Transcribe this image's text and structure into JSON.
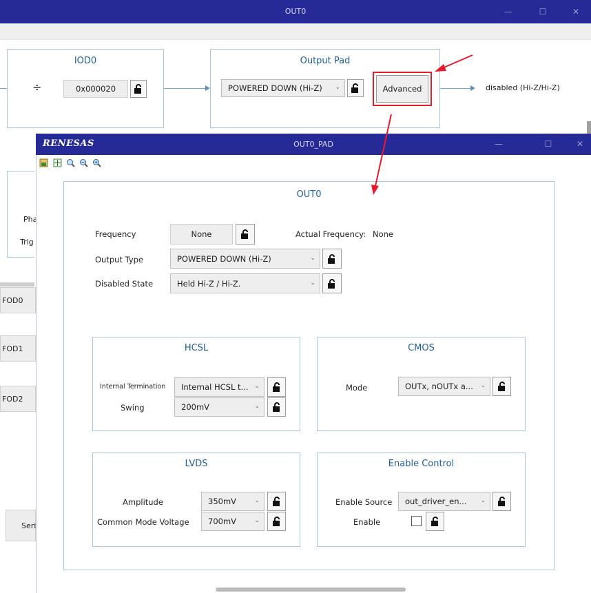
{
  "back_window": {
    "title": "OUT0",
    "iod": {
      "title": "IOD0",
      "divide_symbol": "÷",
      "value": "0x000020"
    },
    "output_pad": {
      "title": "Output Pad",
      "type_value": "POWERED DOWN (Hi-Z)",
      "advanced_label": "Advanced"
    },
    "output_status": "disabled (Hi-Z/Hi-Z)",
    "left_labels": [
      "Pha",
      "Trig"
    ],
    "side_buttons": [
      "FOD0",
      "FOD1",
      "FOD2",
      "Seri"
    ]
  },
  "front_window": {
    "logo": "RENESAS",
    "title": "OUT0_PAD",
    "toolbar": [
      "export-icon",
      "fit-icon",
      "zoom-reset-icon",
      "zoom-out-icon",
      "zoom-in-icon"
    ],
    "main": {
      "title": "OUT0",
      "frequency": {
        "label": "Frequency",
        "value": "None"
      },
      "actual_frequency": {
        "label": "Actual Frequency:",
        "value": "None"
      },
      "output_type": {
        "label": "Output Type",
        "value": "POWERED DOWN (Hi-Z)"
      },
      "disabled_state": {
        "label": "Disabled State",
        "value": "Held Hi-Z / Hi-Z."
      }
    },
    "hcsl": {
      "title": "HCSL",
      "termination": {
        "label": "Internal Termination",
        "value": "Internal HCSL t..."
      },
      "swing": {
        "label": "Swing",
        "value": "200mV"
      }
    },
    "cmos": {
      "title": "CMOS",
      "mode": {
        "label": "Mode",
        "value": "OUTx, nOUTx a..."
      }
    },
    "lvds": {
      "title": "LVDS",
      "amplitude": {
        "label": "Amplitude",
        "value": "350mV"
      },
      "common_mode": {
        "label": "Common Mode Voltage",
        "value": "700mV"
      }
    },
    "enable_control": {
      "title": "Enable Control",
      "source": {
        "label": "Enable Source",
        "value": "out_driver_en..."
      },
      "enable": {
        "label": "Enable",
        "checked": false
      }
    }
  },
  "colors": {
    "titlebar": "#262a96",
    "panel_title": "#1f5f9c",
    "annotation": "#e8192c"
  }
}
